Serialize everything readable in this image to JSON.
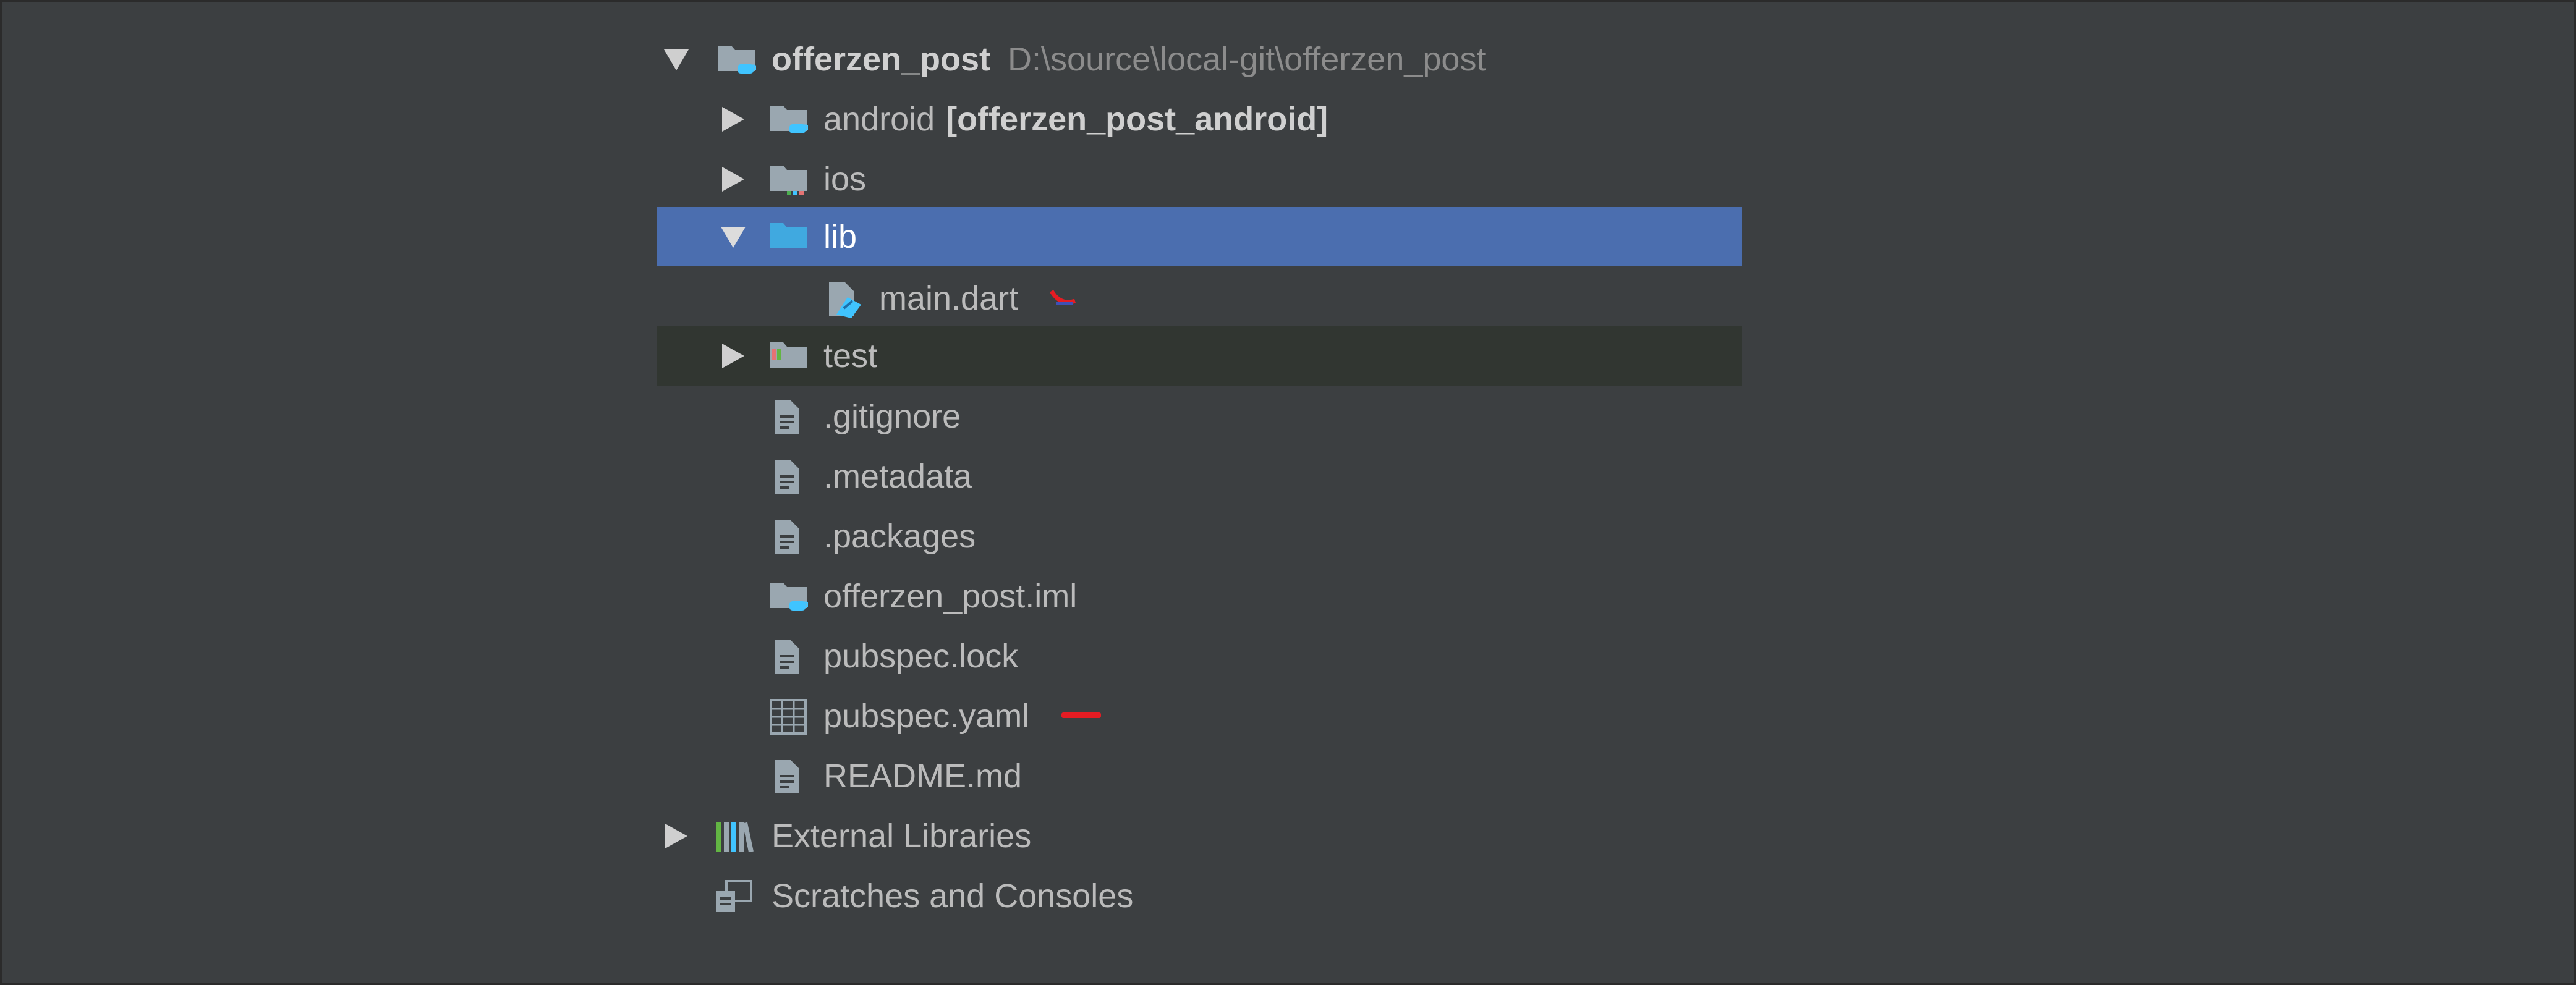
{
  "tree": {
    "root": {
      "name": "offerzen_post",
      "path": "D:\\source\\local-git\\offerzen_post",
      "icon": "flutter-module-folder-icon",
      "expanded": true
    },
    "items": [
      {
        "name": "android",
        "module": "[offerzen_post_android]",
        "icon": "android-module-folder-icon",
        "expanded": false
      },
      {
        "name": "ios",
        "icon": "ios-folder-icon",
        "expanded": false
      },
      {
        "name": "lib",
        "icon": "source-folder-icon",
        "expanded": true,
        "selected": true
      },
      {
        "name": "main.dart",
        "icon": "dart-file-icon",
        "status": "error-badge-icon"
      },
      {
        "name": "test",
        "icon": "test-folder-icon",
        "expanded": false
      },
      {
        "name": ".gitignore",
        "icon": "text-file-icon"
      },
      {
        "name": ".metadata",
        "icon": "text-file-icon"
      },
      {
        "name": ".packages",
        "icon": "text-file-icon"
      },
      {
        "name": "offerzen_post.iml",
        "icon": "iml-module-file-icon"
      },
      {
        "name": "pubspec.lock",
        "icon": "text-file-icon"
      },
      {
        "name": "pubspec.yaml",
        "icon": "yaml-table-file-icon",
        "status": "error-underline-icon"
      },
      {
        "name": "README.md",
        "icon": "text-file-icon"
      }
    ],
    "external_libraries": {
      "name": "External Libraries",
      "icon": "libraries-icon",
      "expanded": false
    },
    "scratches": {
      "name": "Scratches and Consoles",
      "icon": "scratches-icon"
    }
  },
  "colors": {
    "background": "#3c3f41",
    "selection": "#4b6eaf",
    "test_row": "#313631",
    "text": "#bbbbbb",
    "path_text": "#8c8c8c",
    "flutter_blue": "#40c4ff",
    "error_red": "#e51c23"
  }
}
